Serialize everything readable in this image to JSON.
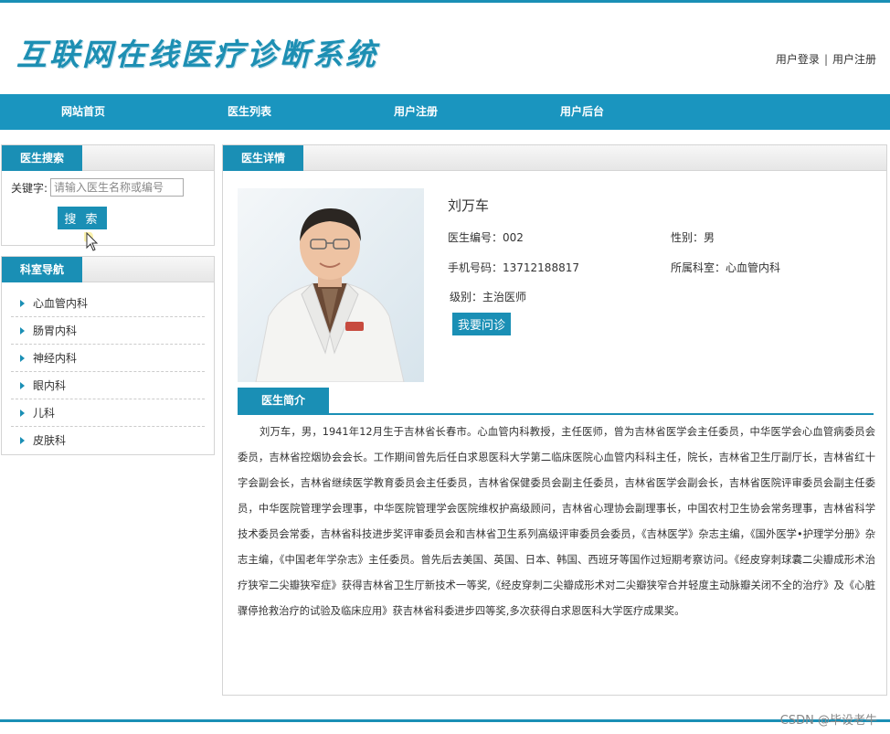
{
  "site": {
    "title": "互联网在线医疗诊断系统"
  },
  "header": {
    "login": "用户登录",
    "separator": "|",
    "register": "用户注册"
  },
  "nav": {
    "items": [
      "网站首页",
      "医生列表",
      "用户注册",
      "用户后台"
    ]
  },
  "search": {
    "title": "医生搜索",
    "label": "关键字:",
    "placeholder": "请输入医生名称或编号",
    "button": "搜 索"
  },
  "departments": {
    "title": "科室导航",
    "items": [
      "心血管内科",
      "肠胃内科",
      "神经内科",
      "眼内科",
      "儿科",
      "皮肤科"
    ]
  },
  "detail": {
    "title": "医生详情",
    "name": "刘万车",
    "id_text": "医生编号：002",
    "gender_text": "性别：男",
    "phone_text": "手机号码：13712188817",
    "dept_text": "所属科室：心血管内科",
    "level_text": "级别：主治医师",
    "consult_button": "我要问诊",
    "intro_title": "医生简介",
    "intro": "刘万车，男，1941年12月生于吉林省长春市。心血管内科教授，主任医师，曾为吉林省医学会主任委员，中华医学会心血管病委员会委员，吉林省控烟协会会长。工作期间曾先后任白求恩医科大学第二临床医院心血管内科科主任，院长，吉林省卫生厅副厅长，吉林省红十字会副会长，吉林省继续医学教育委员会主任委员，吉林省保健委员会副主任委员，吉林省医学会副会长，吉林省医院评审委员会副主任委员，中华医院管理学会理事，中华医院管理学会医院维权护高级顾问，吉林省心理协会副理事长，中国农村卫生协会常务理事，吉林省科学技术委员会常委，吉林省科技进步奖评审委员会和吉林省卫生系列高级评审委员会委员，《吉林医学》杂志主编，《国外医学•护理学分册》杂志主编，《中国老年学杂志》主任委员。曾先后去美国、英国、日本、韩国、西班牙等国作过短期考察访问。《经皮穿刺球囊二尖瓣成形术治疗狭窄二尖瓣狭窄症》获得吉林省卫生厅新技术一等奖,《经皮穿刺二尖瓣成形术对二尖瓣狭窄合并轻度主动脉瓣关闭不全的治疗》及《心脏骤停抢救治疗的试验及临床应用》获吉林省科委进步四等奖,多次获得白求恩医科大学医疗成果奖。"
  },
  "watermark": "CSDN @毕设老牛",
  "colors": {
    "accent": "#1a8fb5",
    "nav": "#1a95bf"
  }
}
